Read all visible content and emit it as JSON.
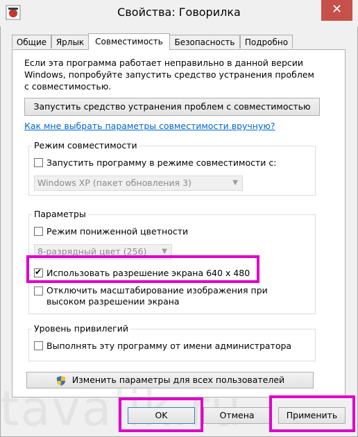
{
  "window": {
    "title": "Свойства: Говорилка",
    "close_glyph": "✕"
  },
  "tabs": [
    {
      "label": "Общие"
    },
    {
      "label": "Ярлык"
    },
    {
      "label": "Совместимость"
    },
    {
      "label": "Безопасность"
    },
    {
      "label": "Подробно"
    }
  ],
  "compat": {
    "intro_lines": [
      "Если эта программа работает неправильно в данной версии",
      "Windows, попробуйте запустить средство устранения проблем",
      "с совместимостью."
    ],
    "troubleshoot_button": "Запустить средство устранения проблем с совместимостью",
    "manual_link": "Как мне выбрать параметры совместимости вручную?",
    "mode_group": {
      "label": "Режим совместимости",
      "run_in_mode_label": "Запустить программу в режиме совместимости с:",
      "run_in_mode_checked": false,
      "os_select_value": "Windows XP (пакет обновления 3)"
    },
    "params_group": {
      "label": "Параметры",
      "reduced_color_label": "Режим пониженной цветности",
      "reduced_color_checked": false,
      "color_select_value": "8-разрядный цвет (256)",
      "res640_label": "Использовать разрешение экрана 640 x 480",
      "res640_checked": true,
      "dpi_label_line1": "Отключить масштабирование изображения при",
      "dpi_label_line2": "высоком разрешении экрана",
      "dpi_checked": false
    },
    "privilege_group": {
      "label": "Уровень привилегий",
      "admin_label": "Выполнять эту программу от имени администратора",
      "admin_checked": false
    },
    "all_users_button": "Изменить параметры для всех пользователей"
  },
  "footer": {
    "ok": "OK",
    "cancel": "Отмена",
    "apply": "Применить"
  },
  "watermark": "tavalik.ru",
  "colors": {
    "highlight": "#e000c8",
    "close": "#c7504b",
    "link": "#0066cc"
  }
}
